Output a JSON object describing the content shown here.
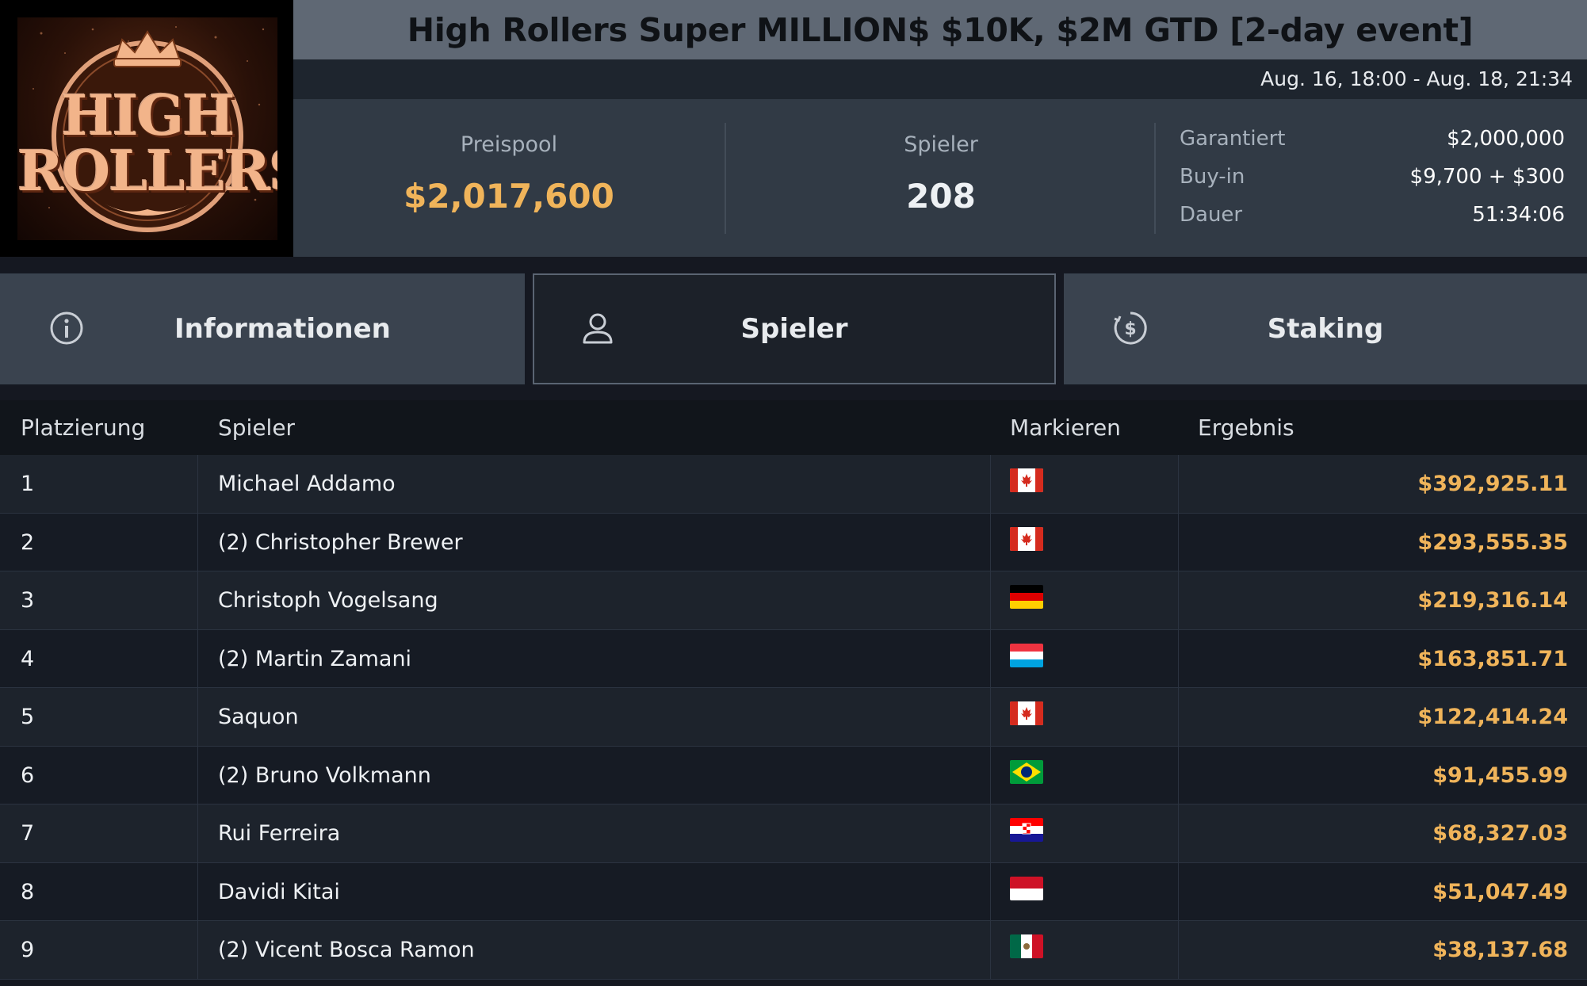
{
  "logo": {
    "line1": "HIGH",
    "line2": "ROLLERS"
  },
  "header": {
    "title": "High Rollers Super MILLION$ $10K, $2M GTD [2-day event]",
    "dates": "Aug. 16, 18:00 - Aug. 18, 21:34"
  },
  "stats": {
    "prizepool_label": "Preispool",
    "prizepool_value": "$2,017,600",
    "players_label": "Spieler",
    "players_value": "208",
    "details": [
      {
        "label": "Garantiert",
        "value": "$2,000,000"
      },
      {
        "label": "Buy-in",
        "value": "$9,700 + $300"
      },
      {
        "label": "Dauer",
        "value": "51:34:06"
      }
    ]
  },
  "tabs": [
    {
      "label": "Informationen",
      "icon": "info-icon",
      "active": false
    },
    {
      "label": "Spieler",
      "icon": "user-icon",
      "active": true
    },
    {
      "label": "Staking",
      "icon": "dollar-coin-icon",
      "active": false
    }
  ],
  "table": {
    "columns": [
      "Platzierung",
      "Spieler",
      "Markieren",
      "Ergebnis"
    ],
    "rows": [
      {
        "rank": "1",
        "name": "Michael Addamo",
        "flag": "canada-flag-icon",
        "prize": "$392,925.11"
      },
      {
        "rank": "2",
        "name": "(2) Christopher Brewer",
        "flag": "canada-flag-icon",
        "prize": "$293,555.35"
      },
      {
        "rank": "3",
        "name": "Christoph Vogelsang",
        "flag": "germany-flag-icon",
        "prize": "$219,316.14"
      },
      {
        "rank": "4",
        "name": "(2) Martin Zamani",
        "flag": "luxembourg-flag-icon",
        "prize": "$163,851.71"
      },
      {
        "rank": "5",
        "name": "Saquon",
        "flag": "canada-flag-icon",
        "prize": "$122,414.24"
      },
      {
        "rank": "6",
        "name": "(2) Bruno Volkmann",
        "flag": "brazil-flag-icon",
        "prize": "$91,455.99"
      },
      {
        "rank": "7",
        "name": "Rui Ferreira",
        "flag": "croatia-flag-icon",
        "prize": "$68,327.03"
      },
      {
        "rank": "8",
        "name": "Davidi Kitai",
        "flag": "monaco-flag-icon",
        "prize": "$51,047.49"
      },
      {
        "rank": "9",
        "name": "(2) Vicent Bosca Ramon",
        "flag": "mexico-flag-icon",
        "prize": "$38,137.68"
      }
    ]
  }
}
